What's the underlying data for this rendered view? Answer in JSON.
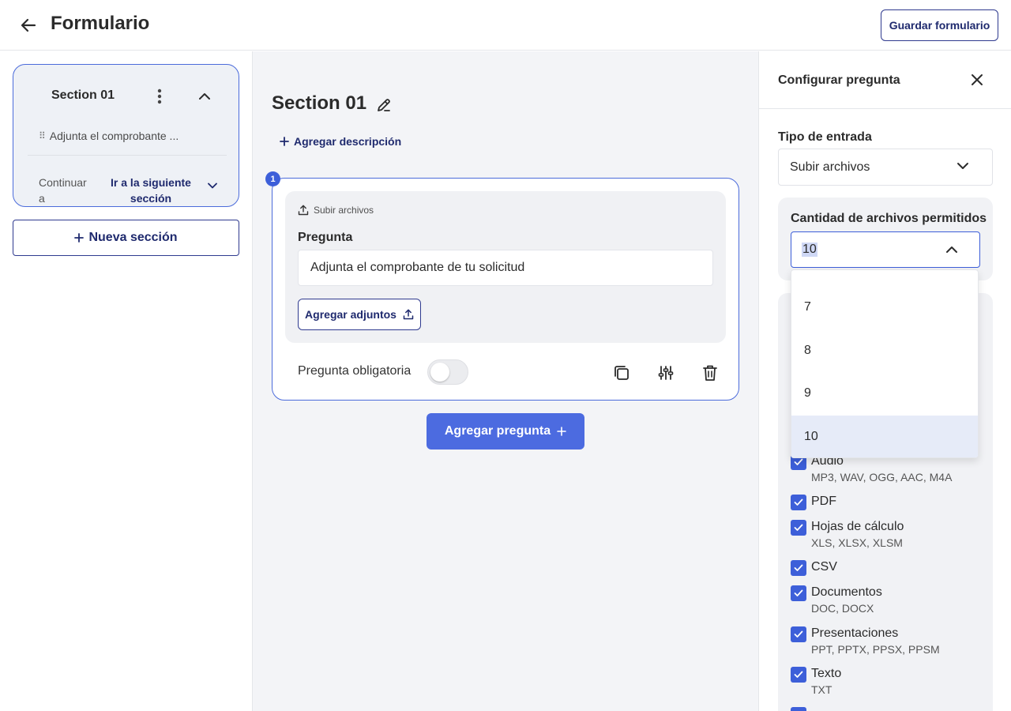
{
  "header": {
    "title": "Formulario",
    "save_label": "Guardar formulario"
  },
  "sidebar": {
    "section_title": "Section 01",
    "question_preview": "Adjunta el comprobante ...",
    "continue_label": "Continuar a",
    "next_section_value": "Ir a la siguiente sección",
    "new_section_label": "Nueva sección"
  },
  "editor": {
    "section_title": "Section 01",
    "add_description_label": "Agregar descripción",
    "question": {
      "number": "1",
      "type_label": "Subir archivos",
      "field_label": "Pregunta",
      "field_value": "Adjunta el comprobante de tu solicitud",
      "attach_label": "Agregar adjuntos",
      "required_label": "Pregunta obligatoria",
      "required": false
    },
    "add_question_label": "Agregar pregunta"
  },
  "config_panel": {
    "title": "Configurar pregunta",
    "entry_type_label": "Tipo de entrada",
    "entry_type_value": "Subir archivos",
    "file_count_label": "Cantidad de archivos permitidos",
    "file_count_value": "10",
    "file_count_options": [
      "7",
      "8",
      "9",
      "10"
    ],
    "file_types": [
      {
        "name": "Audio",
        "extensions": "MP3, WAV, OGG, AAC, M4A",
        "checked": true
      },
      {
        "name": "PDF",
        "extensions": "",
        "checked": true
      },
      {
        "name": "Hojas de cálculo",
        "extensions": "XLS, XLSX, XLSM",
        "checked": true
      },
      {
        "name": "CSV",
        "extensions": "",
        "checked": true
      },
      {
        "name": "Documentos",
        "extensions": "DOC, DOCX",
        "checked": true
      },
      {
        "name": "Presentaciones",
        "extensions": "PPT, PPTX, PPSX, PPSM",
        "checked": true
      },
      {
        "name": "Texto",
        "extensions": "TXT",
        "checked": true
      }
    ]
  },
  "colors": {
    "accent": "#3d5fd9",
    "primary_button": "#4c6be0",
    "dark_navy": "#1f2a6e",
    "selected_option": "#e6ebf8"
  }
}
